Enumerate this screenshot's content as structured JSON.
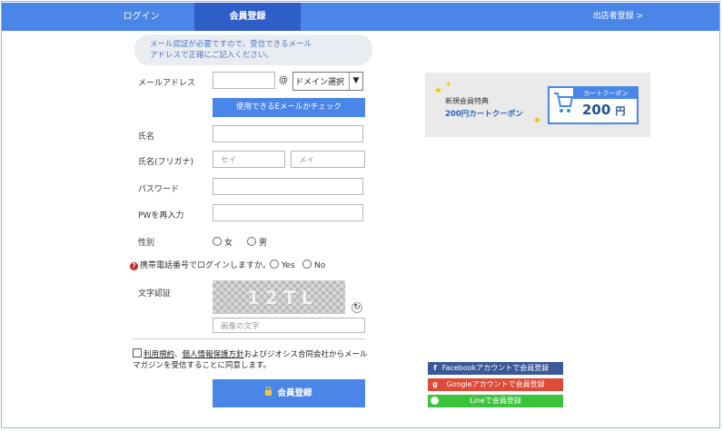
{
  "header": {
    "tabs": [
      {
        "label": "ログイン",
        "active": false
      },
      {
        "label": "会員登録",
        "active": true
      }
    ],
    "shop_link": "出店者登録 >"
  },
  "notice": {
    "line1": "メール認証が必要ですので、受信できるメール",
    "line2": "アドレスで正確にご記入ください。"
  },
  "form": {
    "email_label": "メールアドレス",
    "email_value": "",
    "at_sign": "@",
    "domain_select": "ドメイン選択",
    "check_email_button": "使用できるEメールかチェック",
    "name_label": "氏名",
    "name_value": "",
    "kana_label": "氏名(フリガナ)",
    "kana_sei_placeholder": "セイ",
    "kana_mei_placeholder": "メイ",
    "password_label": "パスワード",
    "password_confirm_label": "PWを再入力",
    "gender_label": "性別",
    "gender_options": [
      "女",
      "男"
    ],
    "mobile_login_question": "携帯電話番号でログインしますか。",
    "mobile_login_options": [
      "Yes",
      "No"
    ],
    "captcha_label": "文字認証",
    "captcha_text": "12TL",
    "captcha_placeholder": "画像の文字",
    "agree_terms": "利用規約",
    "agree_separator": "、",
    "agree_privacy": "個人情報保護方針",
    "agree_rest_line1": "およびジオシス合同会社からメール",
    "agree_line2": "マガジンを受信することに同意します。",
    "submit_button": "会員登録"
  },
  "coupon": {
    "line1": "新規会員特典",
    "line2": "200円カートクーポン",
    "card_title": "カートクーポン",
    "card_value": "200",
    "card_unit": "円"
  },
  "social": [
    {
      "icon": "f",
      "label": "Facebookアカウントで会員登録",
      "color": "#3b5998"
    },
    {
      "icon": "g",
      "label": "Googleアカウントで会員登録",
      "color": "#dd4b39"
    },
    {
      "icon": "L",
      "label": "Lineで会員登録",
      "color": "#3bc43b"
    }
  ],
  "colors": {
    "accent": "#4a86e8",
    "active_tab": "#2f5ec7"
  }
}
